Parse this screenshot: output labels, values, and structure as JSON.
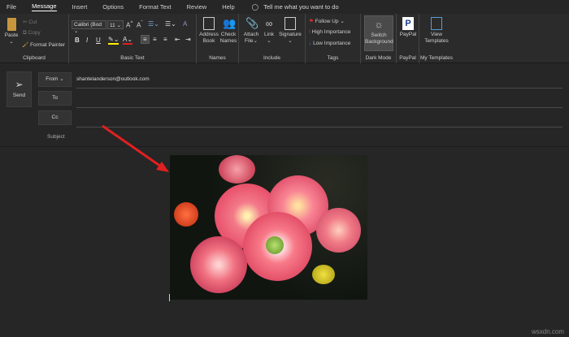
{
  "tabs": [
    "File",
    "Message",
    "Insert",
    "Options",
    "Format Text",
    "Review",
    "Help"
  ],
  "active_tab": "Message",
  "tell_me": "Tell me what you want to do",
  "clipboard": {
    "paste": "Paste",
    "cut": "Cut",
    "copy": "Copy",
    "format_painter": "Format Painter",
    "label": "Clipboard"
  },
  "basic_text": {
    "font": "Calibri (Bod",
    "size": "11",
    "bold": "B",
    "italic": "I",
    "underline": "U",
    "label": "Basic Text"
  },
  "names": {
    "address_book": [
      "Address",
      "Book"
    ],
    "check_names": [
      "Check",
      "Names"
    ],
    "label": "Names"
  },
  "include": {
    "attach": [
      "Attach",
      "File"
    ],
    "link": "Link",
    "signature": "Signature",
    "label": "Include"
  },
  "tags": {
    "follow_up": "Follow Up",
    "high": "High Importance",
    "low": "Low Importance",
    "label": "Tags"
  },
  "dark_mode": {
    "button": [
      "Switch",
      "Background"
    ],
    "label": "Dark Mode"
  },
  "paypal": {
    "button": "PayPal",
    "label": "PayPal"
  },
  "templates": {
    "button": [
      "View",
      "Templates"
    ],
    "label": "My Templates"
  },
  "compose": {
    "send": "Send",
    "from": "From",
    "from_value": "shantelanderson@outlook.com",
    "to": "To",
    "cc": "Cc",
    "subject": "Subject"
  },
  "watermark": "wsxdn.com"
}
